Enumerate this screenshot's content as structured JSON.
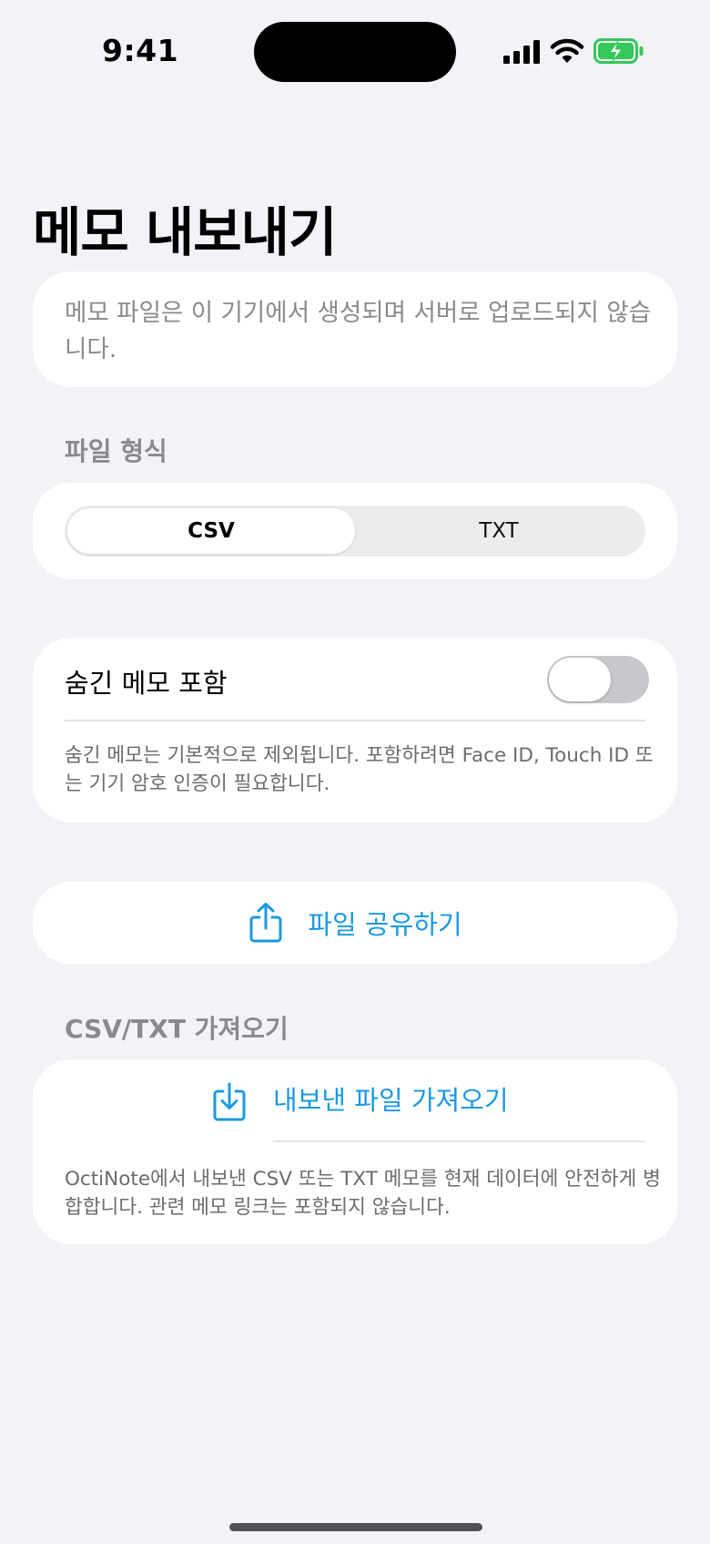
{
  "status_bar": {
    "time": "9:41"
  },
  "page": {
    "title": "메모 내보내기"
  },
  "info": {
    "text": "메모 파일은 이 기기에서 생성되며 서버로 업로드되지 않습니다."
  },
  "format": {
    "header": "파일 형식",
    "options": [
      "CSV",
      "TXT"
    ],
    "selected": "CSV"
  },
  "hidden_memos": {
    "label": "숨긴 메모 포함",
    "enabled": false,
    "note": "숨긴 메모는 기본적으로 제외됩니다. 포함하려면 Face ID, Touch ID 또는 기기 암호 인증이 필요합니다."
  },
  "share": {
    "label": "파일 공유하기",
    "icon": "share-icon"
  },
  "import": {
    "header": "CSV/TXT 가져오기",
    "label": "내보낸 파일 가져오기",
    "icon": "import-icon",
    "note": "OctiNote에서 내보낸 CSV 또는 TXT 메모를 현재 데이터에 안전하게 병합합니다. 관련 메모 링크는 포함되지 않습니다."
  },
  "colors": {
    "accent": "#1a9ae0",
    "background": "#f2f2f7",
    "battery": "#34c759"
  }
}
